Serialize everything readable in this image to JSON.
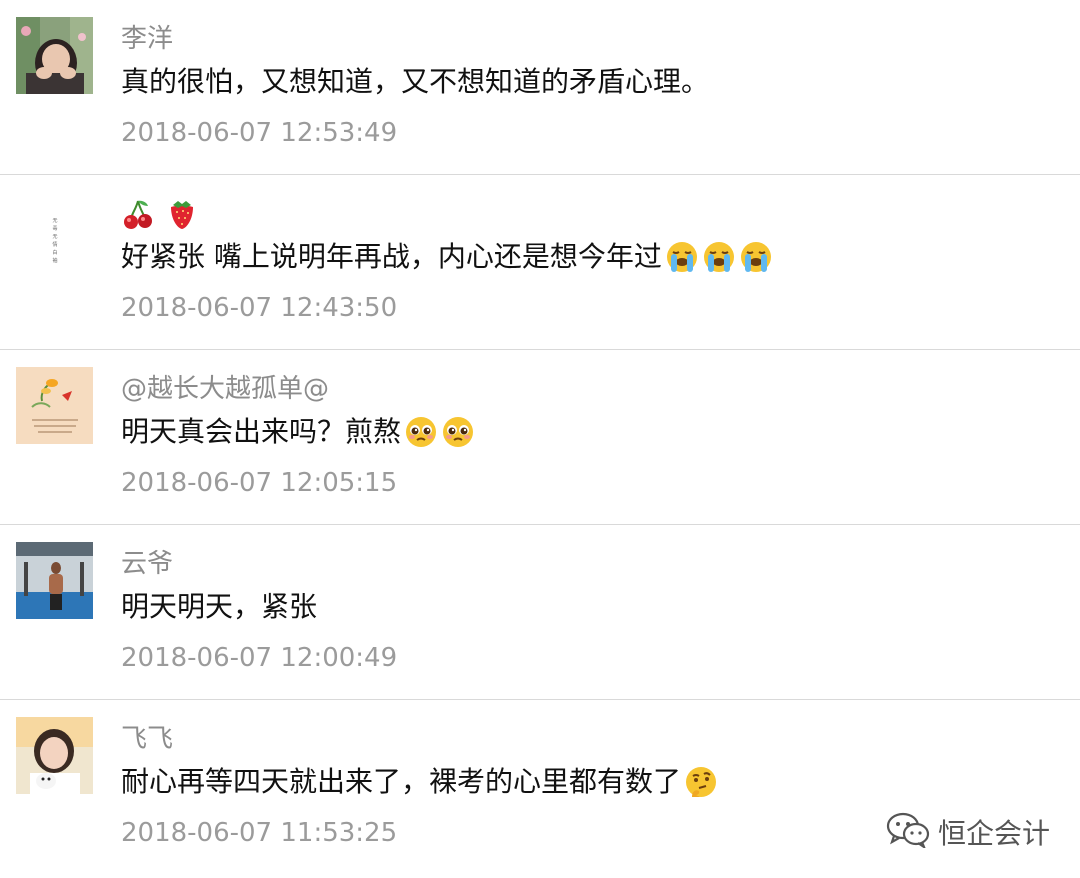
{
  "comments": [
    {
      "nickname": "李洋",
      "content": "真的很怕，又想知道，又不想知道的矛盾心理。",
      "timestamp": "2018-06-07 12:53:49"
    },
    {
      "nickname_emojis": [
        "cherries-emoji",
        "strawberry-emoji"
      ],
      "avatar_text": [
        "无",
        "毒",
        "无",
        "情",
        "白",
        "袖"
      ],
      "content": "好紧张 嘴上说明年再战，内心还是想今年过",
      "content_emojis": [
        "loudly-crying-face-emoji",
        "loudly-crying-face-emoji",
        "loudly-crying-face-emoji"
      ],
      "timestamp": "2018-06-07 12:43:50"
    },
    {
      "nickname": "@越长大越孤单@",
      "content": "明天真会出来吗？煎熬",
      "content_emojis": [
        "pleading-face-emoji",
        "pleading-face-emoji"
      ],
      "timestamp": "2018-06-07 12:05:15"
    },
    {
      "nickname": "云爷",
      "content": "明天明天，紧张",
      "timestamp": "2018-06-07 12:00:49"
    },
    {
      "nickname": "飞飞",
      "content": "耐心再等四天就出来了，裸考的心里都有数了",
      "content_emojis": [
        "thinking-face-emoji"
      ],
      "timestamp": "2018-06-07 11:53:25"
    }
  ],
  "watermark": {
    "icon": "wechat-icon",
    "text": "恒企会计"
  },
  "colors": {
    "nickname": "#8c8c8c",
    "content": "#111111",
    "timestamp": "#9b9b9b",
    "divider": "#d9d9d9"
  }
}
